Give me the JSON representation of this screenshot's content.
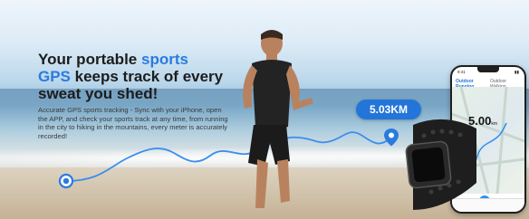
{
  "headline": {
    "part1": "Your portable ",
    "highlight1": "sports",
    "highlight2": "GPS",
    "part2": " keeps track of every sweat you shed!"
  },
  "description": "Accurate GPS sports tracking - Sync with your iPhone, open the APP, and check your sports track at any time, from running in the city to hiking in the mountains, every meter is accurately recorded!",
  "distance_badge": "5.03KM",
  "phone": {
    "time": "9:41",
    "tab_active": "Outdoor Running",
    "tab_other": "Outdoor Walking",
    "distance_value": "5.00",
    "distance_unit": "km"
  },
  "colors": {
    "accent": "#2475d9",
    "headline": "#1c1c1c",
    "route": "#3a8ef0"
  }
}
